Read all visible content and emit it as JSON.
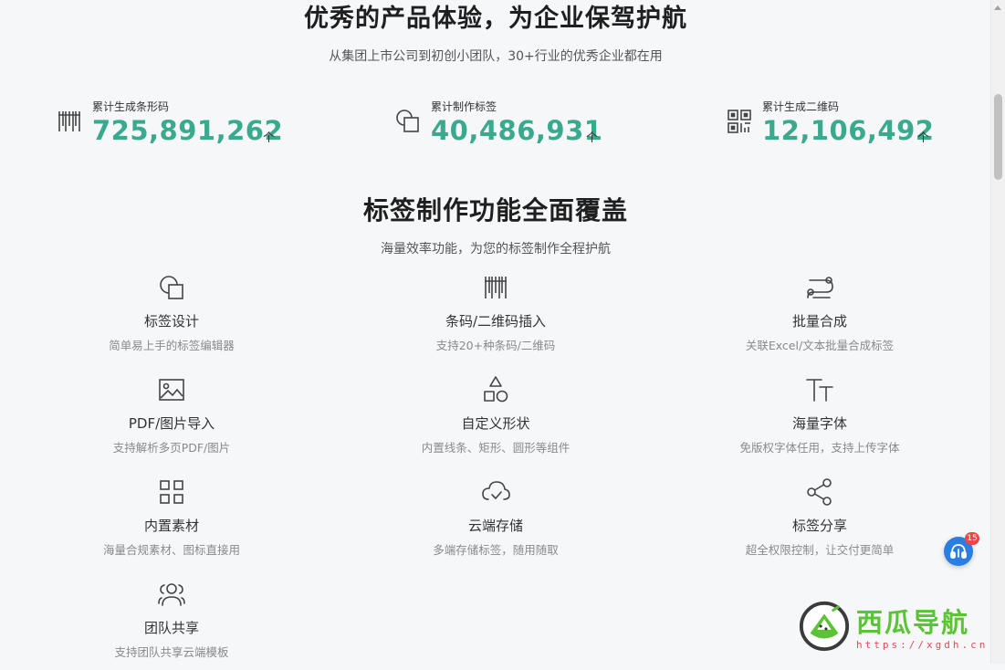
{
  "hero": {
    "title": "优秀的产品体验，为企业保驾护航",
    "subtitle": "从集团上市公司到初创小团队，30+行业的优秀企业都在用"
  },
  "stats": [
    {
      "label": "累计生成条形码",
      "value": "725,891,262",
      "unit": "个",
      "icon": "barcode-icon"
    },
    {
      "label": "累计制作标签",
      "value": "40,486,931",
      "unit": "个",
      "icon": "label-shapes-icon"
    },
    {
      "label": "累计生成二维码",
      "value": "12,106,492",
      "unit": "个",
      "icon": "qrcode-icon"
    }
  ],
  "features_section": {
    "title": "标签制作功能全面覆盖",
    "subtitle": "海量效率功能，为您的标签制作全程护航",
    "items": [
      {
        "title": "标签设计",
        "desc": "简单易上手的标签编辑器",
        "icon": "label-design-icon"
      },
      {
        "title": "条码/二维码插入",
        "desc": "支持20+种条码/二维码",
        "icon": "barcode-icon"
      },
      {
        "title": "批量合成",
        "desc": "关联Excel/文本批量合成标签",
        "icon": "batch-merge-icon"
      },
      {
        "title": "PDF/图片导入",
        "desc": "支持解析多页PDF/图片",
        "icon": "image-import-icon"
      },
      {
        "title": "自定义形状",
        "desc": "内置线条、矩形、圆形等组件",
        "icon": "shapes-icon"
      },
      {
        "title": "海量字体",
        "desc": "免版权字体任用，支持上传字体",
        "icon": "font-icon"
      },
      {
        "title": "内置素材",
        "desc": "海量合规素材、图标直接用",
        "icon": "grid-assets-icon"
      },
      {
        "title": "云端存储",
        "desc": "多端存储标签，随用随取",
        "icon": "cloud-icon"
      },
      {
        "title": "标签分享",
        "desc": "超全权限控制，让交付更简单",
        "icon": "share-icon"
      },
      {
        "title": "团队共享",
        "desc": "支持团队共享云端模板",
        "icon": "team-icon"
      }
    ]
  },
  "float_button": {
    "badge": "15",
    "icon": "support-icon"
  },
  "watermark": {
    "text": "西瓜导航",
    "url": "https://xgdh.cn",
    "icon": "watermelon-logo-icon"
  },
  "colors": {
    "accent": "#3aaa8f",
    "float": "#2a7de1",
    "badge": "#f04545",
    "watermark": "#5ac435"
  }
}
